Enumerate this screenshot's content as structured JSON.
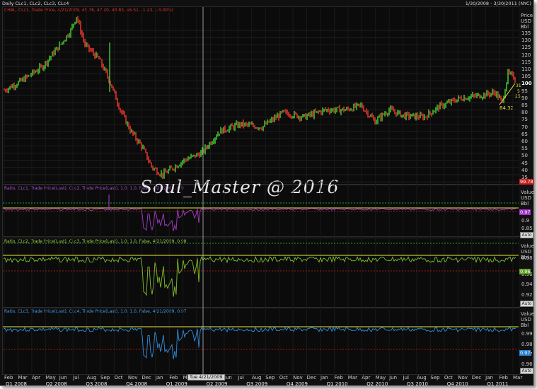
{
  "header": {
    "title": "Daily CLc1, CLc2, CLc3, CLc4",
    "range": "1/30/2008 - 3/30/2011 (NYC)"
  },
  "price_panel": {
    "title": "CHAL, CLc1, Trade Price, 4/21/2009, 45.76, 47.20, 43.83, 46.51, -1.23, (-3.00%)",
    "axis_label": [
      "Price",
      "USD",
      "Bbl"
    ],
    "ticks": [
      "135",
      "130",
      "125",
      "120",
      "115",
      "110",
      "105",
      "100",
      "95",
      "90",
      "85",
      "80",
      "75",
      "70",
      "65",
      "60",
      "55",
      "50",
      "45",
      "40",
      "35"
    ],
    "last_value": "99.78",
    "low_label": "84.32",
    "small_labels": [
      "31",
      "5",
      "25"
    ]
  },
  "ratio1": {
    "title": "Ratio, CLc1, Trade Price(Last), CLc2, Trade Price(Last), 1.0, 1.0, False, 4/21/2009, 0.9",
    "axis_label": [
      "Value",
      "USD",
      "Bbl"
    ],
    "ticks": [
      "0.9",
      "0.85"
    ],
    "last_value": "0.97",
    "auto": "Auto"
  },
  "ratio2": {
    "title": "Ratio, CLc2, Trade Price(Last), CLc3, Trade Price(Last), 1.0, 1.0, False, 4/21/2009, 0.98",
    "axis_label": [
      "Value",
      "USD",
      "Bbl"
    ],
    "ticks": [
      "0.98",
      "0.96",
      "0.94",
      "0.92"
    ],
    "last_value": "0.96",
    "auto": "Auto"
  },
  "ratio3": {
    "title": "Ratio, CLc3, Trade Price(Last), CLc4, Trade Price(Last), 1.0, 1.0, False, 4/21/2009, 0.97",
    "axis_label": [
      "Value",
      "USD",
      "Bbl"
    ],
    "ticks": [
      "0.99",
      "0.98",
      "0.97",
      "0.96"
    ],
    "last_value": "0.97",
    "auto": "Auto"
  },
  "x_axis": {
    "months": [
      "Feb",
      "Mar",
      "Apr",
      "May",
      "Jun",
      "Jul",
      "Aug",
      "Sep",
      "Oct",
      "Nov",
      "Dec",
      "Jan",
      "Feb",
      "Mar",
      "Apr",
      "May",
      "Jun",
      "Jul",
      "Aug",
      "Sep",
      "Oct",
      "Nov",
      "Dec",
      "Jan",
      "Feb",
      "Mar",
      "Apr",
      "May",
      "Jun",
      "Jul",
      "Aug",
      "Sep",
      "Oct",
      "Nov",
      "Dec",
      "Jan",
      "Feb",
      "Mar"
    ],
    "quarters": [
      "Q1 2008",
      "Q2 2008",
      "Q3 2008",
      "Q4 2008",
      "Q1 2009",
      "Q2 2009",
      "Q3 2009",
      "Q4 2009",
      "Q1 2010",
      "Q2 2010",
      "Q3 2010",
      "Q4 2010",
      "Q1 2011"
    ],
    "cursor_date": "Tue 4/21/2009"
  },
  "watermark": "Soul_Master @ 2016",
  "colors": {
    "up": "#3fbf2f",
    "down": "#d8342c",
    "ratio1": "#a83cc8",
    "ratio2": "#7fbf2a",
    "ratio3": "#2e8fe0",
    "yellow": "#e8e840",
    "redline": "#d02020",
    "greenline": "#30d050"
  }
}
